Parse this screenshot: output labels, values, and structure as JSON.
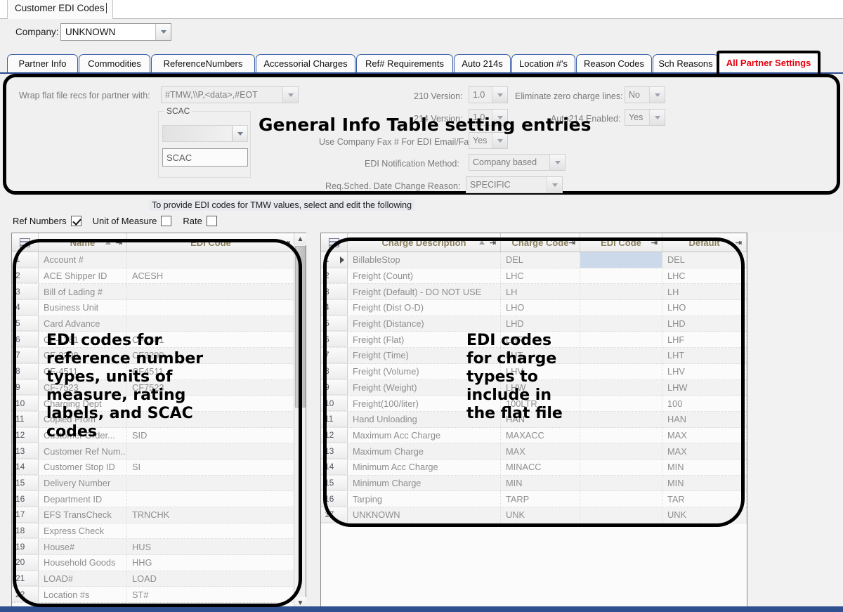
{
  "window": {
    "doc_tab": "Customer EDI Codes"
  },
  "company": {
    "label": "Company:",
    "value": "UNKNOWN",
    "dropdown_icon": "chevron-down-icon"
  },
  "tabs": [
    {
      "label": "Partner Info",
      "active": false
    },
    {
      "label": "Commodities",
      "active": false
    },
    {
      "label": "ReferenceNumbers",
      "active": false
    },
    {
      "label": "Accessorial Charges",
      "active": false
    },
    {
      "label": "Ref# Requirements",
      "active": false
    },
    {
      "label": "Auto 214s",
      "active": false
    },
    {
      "label": "Location #'s",
      "active": false
    },
    {
      "label": "Reason Codes",
      "active": false
    },
    {
      "label": "Sch Reasons",
      "active": false
    },
    {
      "label": "All Partner Settings",
      "active": true
    }
  ],
  "general_info": {
    "annotation": "General Info Table setting entries",
    "wrap_label": "Wrap flat file recs for partner with:",
    "wrap_value": "#TMW,\\\\P,<data>,#EOT",
    "scac_group_legend": "SCAC",
    "scac_combo_value": "",
    "scac_text_value": "SCAC",
    "fields": [
      {
        "label": "210 Version:",
        "value": "1.0"
      },
      {
        "label": "Eliminate zero charge lines:",
        "value": "No"
      },
      {
        "label": "214 Version:",
        "value": "1.0"
      },
      {
        "label": "Auto214 Enabled:",
        "value": "Yes"
      },
      {
        "label": "Use Company Fax # For EDI Email/Fax:",
        "value": "Yes"
      },
      {
        "label": "EDI Notification Method:",
        "value": "Company based"
      },
      {
        "label": "Req.Sched. Date Change Reason:",
        "value": "SPECIFIC"
      }
    ]
  },
  "selector_bar": {
    "hint": "To provide EDI codes for TMW values, select and edit the following",
    "options": [
      {
        "label": "Ref Numbers",
        "checked": true
      },
      {
        "label": "Unit of Measure",
        "checked": false
      },
      {
        "label": "Rate",
        "checked": false
      }
    ]
  },
  "left_grid": {
    "annotation": "EDI codes for\nreference number\ntypes, units of\nmeasure, rating\nlabels, and SCAC\ncodes",
    "columns": [
      "Name",
      "EDI Code"
    ],
    "rows": [
      {
        "n": "1",
        "name": "Account #",
        "code": ""
      },
      {
        "n": "2",
        "name": "ACE Shipper ID",
        "code": "ACESH"
      },
      {
        "n": "3",
        "name": "Bill of Lading #",
        "code": ""
      },
      {
        "n": "4",
        "name": "Business Unit",
        "code": ""
      },
      {
        "n": "5",
        "name": "Card Advance",
        "code": ""
      },
      {
        "n": "6",
        "name": "CF-1381",
        "code": "CF1381"
      },
      {
        "n": "7",
        "name": "CF-3299",
        "code": "CF3299"
      },
      {
        "n": "8",
        "name": "CF-4511",
        "code": "CF4511"
      },
      {
        "n": "9",
        "name": "CF-7523",
        "code": "CF7523"
      },
      {
        "n": "10",
        "name": "Charging Dept",
        "code": ""
      },
      {
        "n": "11",
        "name": "Copied From",
        "code": ""
      },
      {
        "n": "12",
        "name": "Customer Order...",
        "code": "SID"
      },
      {
        "n": "13",
        "name": "Customer Ref Num...",
        "code": ""
      },
      {
        "n": "14",
        "name": "Customer Stop ID",
        "code": "SI"
      },
      {
        "n": "15",
        "name": "Delivery Number",
        "code": ""
      },
      {
        "n": "16",
        "name": "Department ID",
        "code": ""
      },
      {
        "n": "17",
        "name": "EFS TransCheck",
        "code": "TRNCHK"
      },
      {
        "n": "18",
        "name": "Express Check",
        "code": ""
      },
      {
        "n": "19",
        "name": "House#",
        "code": "HUS"
      },
      {
        "n": "20",
        "name": "Household Goods",
        "code": "HHG"
      },
      {
        "n": "21",
        "name": "LOAD#",
        "code": "LOAD"
      },
      {
        "n": "22",
        "name": "Location #s",
        "code": "ST#"
      }
    ]
  },
  "right_grid": {
    "annotation": "EDI codes\nfor charge\ntypes to\ninclude in\nthe flat file",
    "columns": [
      "Charge Description",
      "Charge Code",
      "EDI Code",
      "Default"
    ],
    "rows": [
      {
        "n": "1",
        "desc": "BillableStop",
        "charge": "DEL",
        "edi": "",
        "default": "DEL"
      },
      {
        "n": "2",
        "desc": "Freight (Count)",
        "charge": "LHC",
        "edi": "",
        "default": "LHC"
      },
      {
        "n": "3",
        "desc": "Freight (Default) - DO NOT USE",
        "charge": "LH",
        "edi": "",
        "default": "LH"
      },
      {
        "n": "4",
        "desc": "Freight (Dist O-D)",
        "charge": "LHO",
        "edi": "",
        "default": "LHO"
      },
      {
        "n": "5",
        "desc": "Freight (Distance)",
        "charge": "LHD",
        "edi": "",
        "default": "LHD"
      },
      {
        "n": "6",
        "desc": "Freight (Flat)",
        "charge": "LHF",
        "edi": "",
        "default": "LHF"
      },
      {
        "n": "7",
        "desc": "Freight (Time)",
        "charge": "LHT",
        "edi": "",
        "default": "LHT"
      },
      {
        "n": "8",
        "desc": "Freight (Volume)",
        "charge": "LHV",
        "edi": "",
        "default": "LHV"
      },
      {
        "n": "9",
        "desc": "Freight (Weight)",
        "charge": "LHW",
        "edi": "",
        "default": "LHW"
      },
      {
        "n": "10",
        "desc": "Freight(100/liter)",
        "charge": "100LTR",
        "edi": "",
        "default": "100"
      },
      {
        "n": "11",
        "desc": "Hand Unloading",
        "charge": "HAN",
        "edi": "",
        "default": "HAN"
      },
      {
        "n": "12",
        "desc": "Maximum Acc Charge",
        "charge": "MAXACC",
        "edi": "",
        "default": "MAX"
      },
      {
        "n": "13",
        "desc": "Maximum Charge",
        "charge": "MAX",
        "edi": "",
        "default": "MAX"
      },
      {
        "n": "14",
        "desc": "Minimum Acc Charge",
        "charge": "MINACC",
        "edi": "",
        "default": "MIN"
      },
      {
        "n": "15",
        "desc": "Minimum Charge",
        "charge": "MIN",
        "edi": "",
        "default": "MIN"
      },
      {
        "n": "16",
        "desc": "Tarping",
        "charge": "TARP",
        "edi": "",
        "default": "TAR"
      },
      {
        "n": "17",
        "desc": "UNKNOWN",
        "charge": "UNK",
        "edi": "",
        "default": "UNK"
      }
    ]
  },
  "colors": {
    "tab_border": "#3a5fa8",
    "active_tab_text": "#e8000d",
    "header_text": "#8a7f5e",
    "annotation": "#000000",
    "selected_cell": "#ccd9ea"
  }
}
